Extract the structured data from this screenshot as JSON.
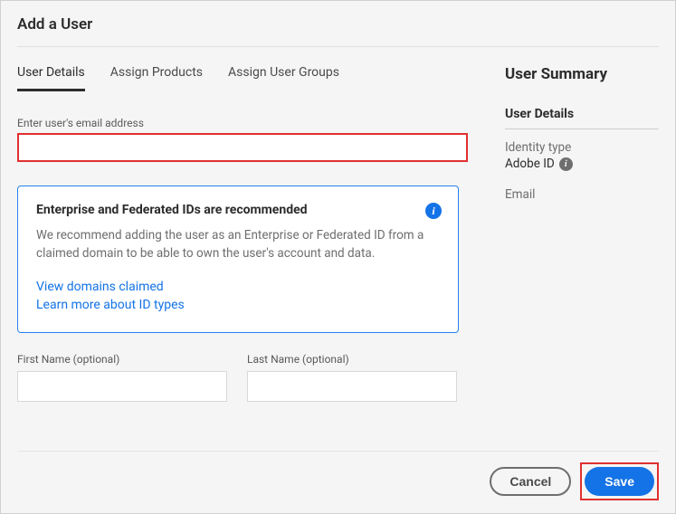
{
  "dialog": {
    "title": "Add a User"
  },
  "tabs": {
    "items": [
      {
        "label": "User Details",
        "active": true
      },
      {
        "label": "Assign Products",
        "active": false
      },
      {
        "label": "Assign User Groups",
        "active": false
      }
    ]
  },
  "form": {
    "email_label": "Enter user's email address",
    "first_name_label": "First Name (optional)",
    "last_name_label": "Last Name (optional)"
  },
  "infobox": {
    "title": "Enterprise and Federated IDs are recommended",
    "text": "We recommend adding the user as an Enterprise or Federated ID from a claimed domain to be able to own the user's account and data.",
    "link_domains": "View domains claimed",
    "link_learn": "Learn more about ID types"
  },
  "summary": {
    "title": "User Summary",
    "section": "User Details",
    "identity_label": "Identity type",
    "identity_value": "Adobe ID",
    "email_label": "Email"
  },
  "footer": {
    "cancel": "Cancel",
    "save": "Save"
  }
}
